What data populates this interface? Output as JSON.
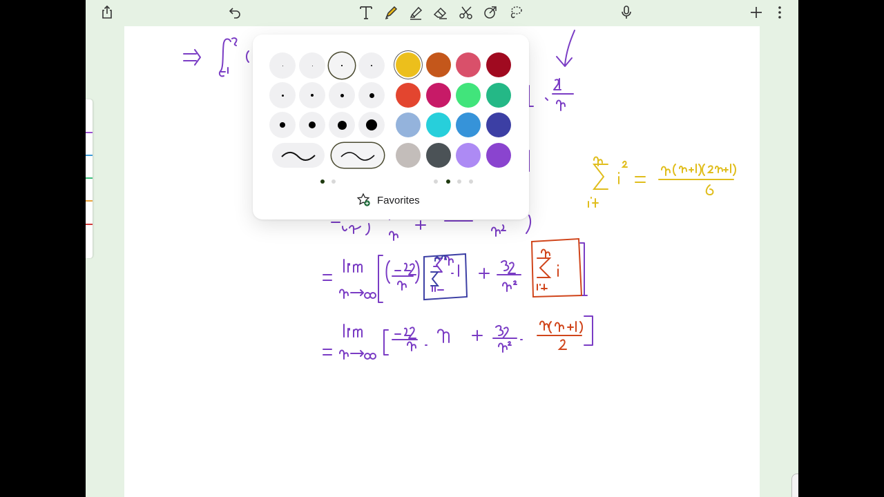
{
  "toolbar": {
    "left": [
      "share-icon",
      "undo-icon"
    ],
    "tools": [
      "text-tool-icon",
      "pen-tool-icon",
      "highlighter-tool-icon",
      "eraser-tool-icon",
      "scissors-tool-icon",
      "shape-tool-icon",
      "lasso-tool-icon"
    ],
    "selected_tool": "pen-tool-icon",
    "right": [
      "microphone-icon",
      "add-icon",
      "more-icon"
    ]
  },
  "colors": {
    "accent": "#e8b81a",
    "ink_purple": "#7a3cc4",
    "ink_yellow": "#e0bd1c",
    "ink_red": "#d0451b"
  },
  "popover": {
    "size_dot_diameters": [
      [
        1,
        1,
        1.5,
        2
      ],
      [
        3,
        4,
        5,
        7
      ],
      [
        8,
        10,
        13,
        16
      ]
    ],
    "selected_size": [
      0,
      2
    ],
    "palette": [
      [
        "#ecbf1c",
        "#c4571b",
        "#d9506a",
        "#a00a20"
      ],
      [
        "#e3452f",
        "#c71a67",
        "#41e47b",
        "#24b886"
      ],
      [
        "#94b3dc",
        "#27cfdb",
        "#3693d9",
        "#3c3fa4"
      ],
      [
        "#c3bdba",
        "#4b5256",
        "#ad8af4",
        "#8a44cf"
      ]
    ],
    "selected_color": [
      0,
      0
    ],
    "favorites_label": "Favorites"
  },
  "side_tab_colors": [
    "#9a4fd0",
    "#3c9bd6",
    "#3bbd78",
    "#e8a23a",
    "#d23a3a"
  ]
}
